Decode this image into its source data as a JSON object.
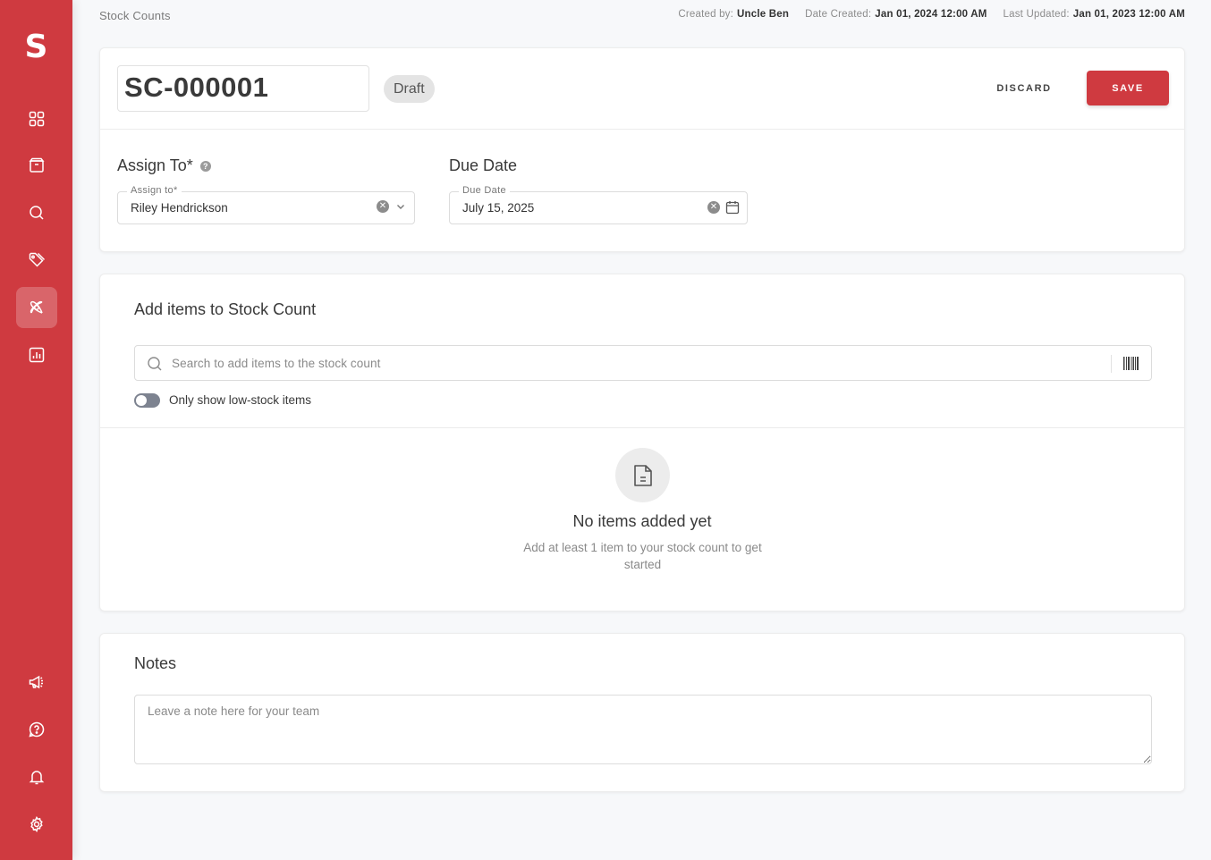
{
  "app": {
    "logo_letter": "S",
    "brand_color": "#cf3a40"
  },
  "sidebar": {
    "top_items": [
      {
        "icon": "dashboard-icon",
        "active": false
      },
      {
        "icon": "inventory-box-icon",
        "active": false
      },
      {
        "icon": "search-icon",
        "active": false
      },
      {
        "icon": "tags-icon",
        "active": false
      },
      {
        "icon": "stock-count-icon",
        "active": true
      },
      {
        "icon": "reports-chart-icon",
        "active": false
      }
    ],
    "bottom_items": [
      {
        "icon": "megaphone-icon"
      },
      {
        "icon": "help-icon"
      },
      {
        "icon": "bell-icon"
      },
      {
        "icon": "gear-icon"
      }
    ]
  },
  "header": {
    "breadcrumb": "Stock Counts",
    "created_by_label": "Created by:",
    "created_by_value": "Uncle Ben",
    "date_created_label": "Date Created:",
    "date_created_value": "Jan 01, 2024 12:00 AM",
    "last_updated_label": "Last Updated:",
    "last_updated_value": "Jan 01, 2023 12:00 AM"
  },
  "record": {
    "id": "SC-000001",
    "status": "Draft",
    "discard_label": "DISCARD",
    "save_label": "SAVE"
  },
  "assign": {
    "section_label": "Assign To*",
    "field_label": "Assign to*",
    "value": "Riley Hendrickson"
  },
  "due": {
    "section_label": "Due Date",
    "field_label": "Due Date",
    "value": "July 15, 2025"
  },
  "items": {
    "title": "Add items to Stock Count",
    "search_placeholder": "Search to add items to the stock count",
    "toggle_label": "Only show low-stock items",
    "toggle_on": false,
    "empty_title": "No items added yet",
    "empty_subtitle": "Add at least 1 item to your stock count to get started"
  },
  "notes": {
    "title": "Notes",
    "placeholder": "Leave a note here for your team",
    "value": ""
  }
}
